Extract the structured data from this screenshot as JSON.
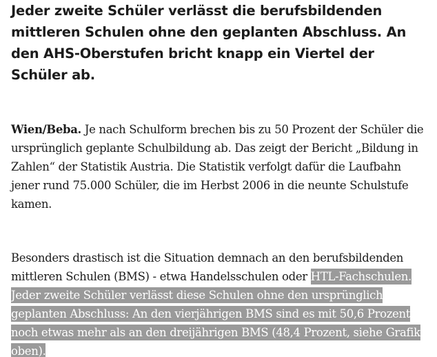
{
  "article": {
    "lead": "Jeder zweite Schüler verlässt die berufsbildenden mittleren Schulen ohne den geplanten Abschluss. An den AHS-Oberstufen bricht knapp ein Viertel der Schüler ab.",
    "paragraph_1": {
      "dateline": "Wien/Beba.",
      "text": " Je nach Schulform brechen bis zu 50 Prozent der Schüler die ursprünglich geplante Schulbildung ab. Das zeigt der Bericht „Bildung in Zahlen“ der Statistik Austria. Die Statistik verfolgt dafür die Laufbahn jener rund 75.000 Schüler, die im Herbst 2006 in die neunte Schulstufe kamen."
    },
    "paragraph_2": {
      "text_before_selection": "Besonders drastisch ist die Situation demnach an den berufsbildenden mittleren Schulen (BMS) - etwa Handelsschulen oder ",
      "selected_text": "HTL-Fachschulen. Jeder zweite Schüler verlässt diese Schulen ohne den ursprünglich geplanten Abschluss: An den vierjährigen BMS sind es mit 50,6 Prozent noch etwas mehr als an den dreijährigen BMS (48,4 Prozent, siehe Grafik oben)."
    }
  },
  "colors": {
    "text": "#1c1c1c",
    "selection_background": "#9a9a9a",
    "selection_text": "#ffffff",
    "page_background": "#ffffff"
  }
}
